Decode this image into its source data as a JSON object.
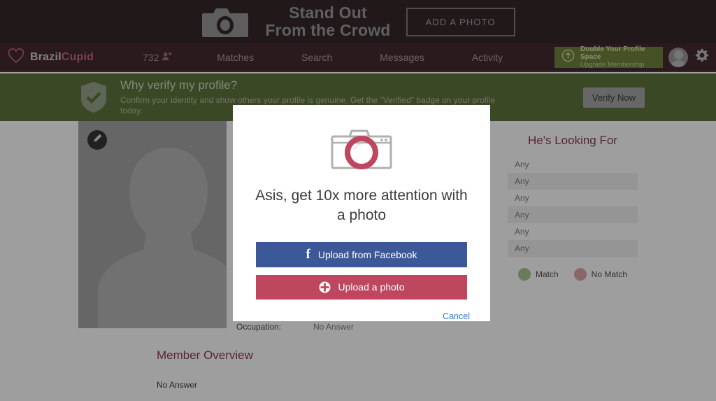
{
  "promo": {
    "icon": "camera-icon",
    "line1": "Stand Out",
    "line2": "From the Crowd",
    "button_label": "ADD A PHOTO"
  },
  "nav": {
    "logo_icon": "heart-icon",
    "brand_first": "Brazil",
    "brand_second": "Cupid",
    "count": "732",
    "count_icon": "people-icon",
    "links": [
      {
        "label": "Matches"
      },
      {
        "label": "Search"
      },
      {
        "label": "Messages"
      },
      {
        "label": "Activity"
      }
    ],
    "upgrade": {
      "icon": "up-arrow-circle-icon",
      "title": "Double Your Profile Space",
      "subtitle": "Upgrade Membership"
    },
    "avatar_icon": "user-avatar-icon",
    "settings_icon": "gear-icon"
  },
  "verify": {
    "icon": "shield-check-icon",
    "title": "Why verify my profile?",
    "subtitle": "Confirm your identity and show others your profile is genuine. Get the \"Verified\" badge on your profile today.",
    "button_label": "Verify Now"
  },
  "profile": {
    "edit_icon": "pencil-icon",
    "photo_placeholder_icon": "person-silhouette-icon",
    "details": [
      {
        "label": "Occupation:",
        "value": "No Answer"
      }
    ]
  },
  "looking_for": {
    "title": "He's Looking For",
    "rows": [
      "Any",
      "Any",
      "Any",
      "Any",
      "Any",
      "Any"
    ],
    "legend": [
      {
        "label": "Match",
        "color": "#9fc183"
      },
      {
        "label": "No Match",
        "color": "#d79b9b"
      }
    ]
  },
  "overview": {
    "title": "Member Overview",
    "body": "No Answer"
  },
  "modal": {
    "icon": "camera-icon",
    "title": "Asis, get 10x more attention with a photo",
    "facebook_button": {
      "icon": "facebook-icon",
      "label": "Upload from Facebook",
      "color": "#3b5998"
    },
    "upload_button": {
      "icon": "plus-circle-icon",
      "label": "Upload a photo",
      "color": "#bf465f"
    },
    "cancel_label": "Cancel"
  }
}
